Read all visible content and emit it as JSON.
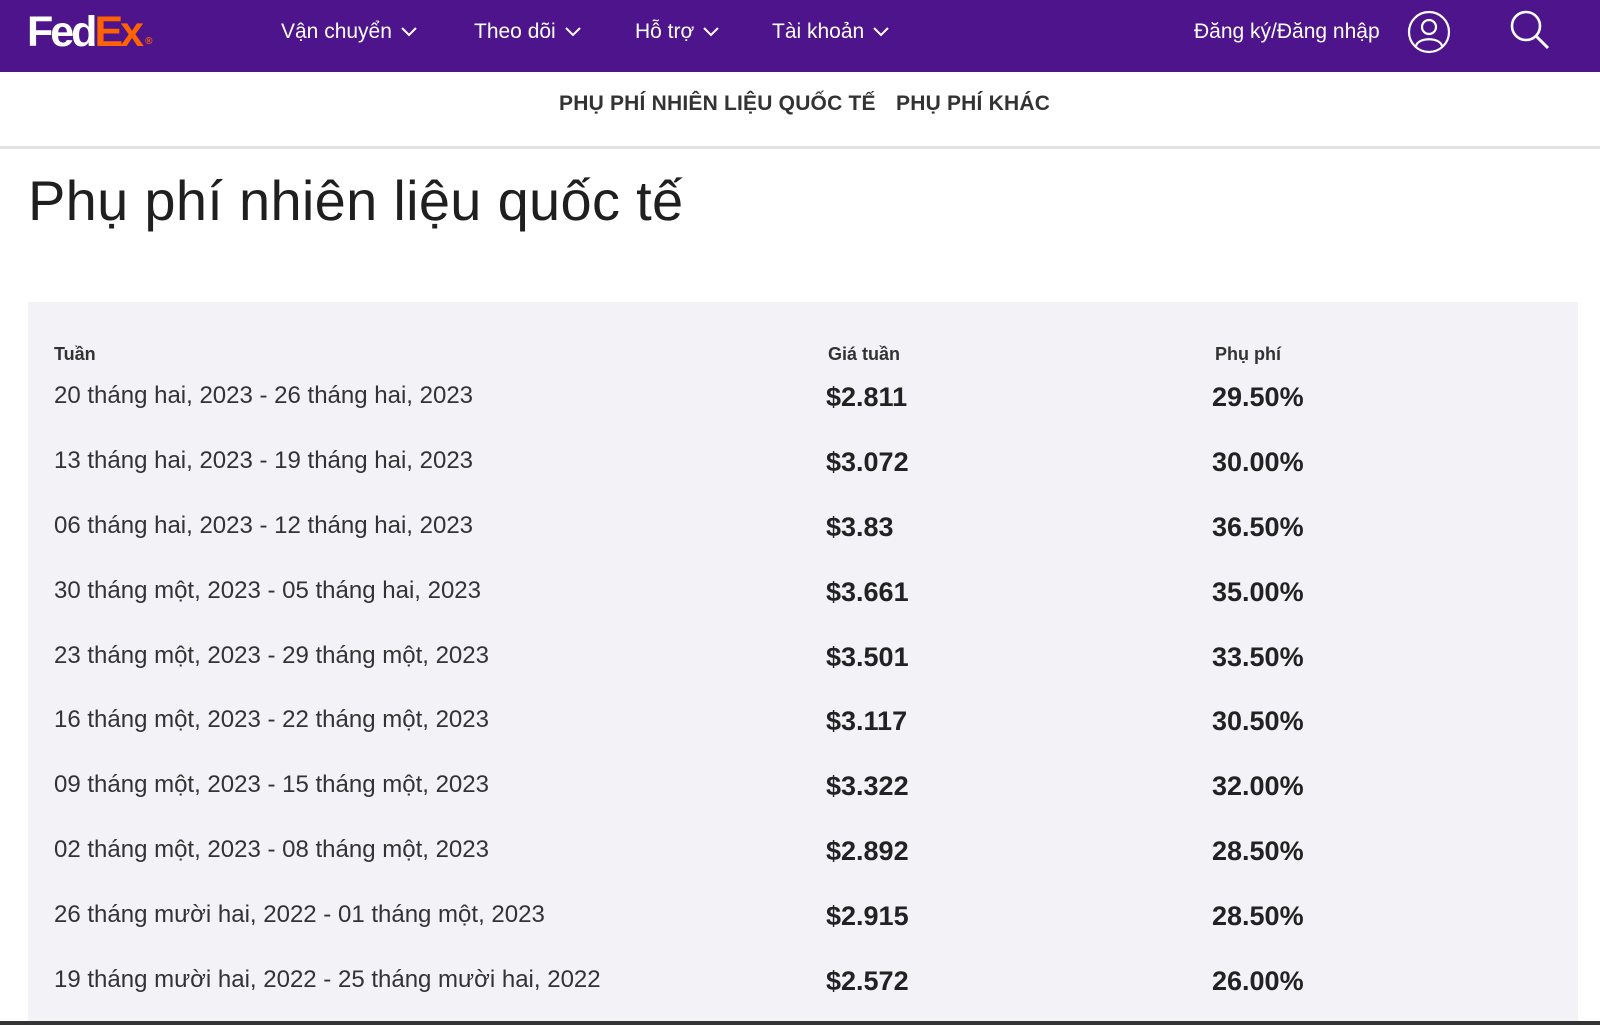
{
  "brand": {
    "fed": "Fed",
    "ex": "Ex",
    "reg": "®"
  },
  "nav": {
    "items": [
      {
        "label": "Vận chuyển"
      },
      {
        "label": "Theo dõi"
      },
      {
        "label": "Hỗ trợ"
      },
      {
        "label": "Tài khoản"
      }
    ],
    "login_label": "Đăng ký/Đăng nhập",
    "user_icon": "user-icon",
    "search_icon": "search-icon"
  },
  "subnav": {
    "links": [
      {
        "label": "PHỤ PHÍ NHIÊN LIỆU QUỐC TẾ"
      },
      {
        "label": "PHỤ PHÍ KHÁC"
      }
    ]
  },
  "page": {
    "title": "Phụ phí nhiên liệu quốc tế"
  },
  "table": {
    "headers": {
      "week": "Tuần",
      "price": "Giá tuần",
      "fee": "Phụ phí"
    },
    "rows": [
      {
        "week": "20 tháng hai, 2023 - 26 tháng hai, 2023",
        "price": "$2.811",
        "fee": "29.50%"
      },
      {
        "week": "13 tháng hai, 2023 - 19 tháng hai, 2023",
        "price": "$3.072",
        "fee": "30.00%"
      },
      {
        "week": "06 tháng hai, 2023 - 12 tháng hai, 2023",
        "price": "$3.83",
        "fee": "36.50%"
      },
      {
        "week": "30 tháng một, 2023 - 05 tháng hai, 2023",
        "price": "$3.661",
        "fee": "35.00%"
      },
      {
        "week": "23 tháng một, 2023 - 29 tháng một, 2023",
        "price": "$3.501",
        "fee": "33.50%"
      },
      {
        "week": "16 tháng một, 2023 - 22 tháng một, 2023",
        "price": "$3.117",
        "fee": "30.50%"
      },
      {
        "week": "09 tháng một, 2023 - 15 tháng một, 2023",
        "price": "$3.322",
        "fee": "32.00%"
      },
      {
        "week": "02 tháng một, 2023 - 08 tháng một, 2023",
        "price": "$2.892",
        "fee": "28.50%"
      },
      {
        "week": "26 tháng mười hai, 2022 - 01 tháng một, 2023",
        "price": "$2.915",
        "fee": "28.50%"
      },
      {
        "week": "19 tháng mười hai, 2022 - 25 tháng mười hai, 2022",
        "price": "$2.572",
        "fee": "26.00%"
      }
    ]
  },
  "colors": {
    "brand_purple": "#4d148c",
    "brand_orange": "#ff6200",
    "panel_bg": "#f2f2f7"
  }
}
